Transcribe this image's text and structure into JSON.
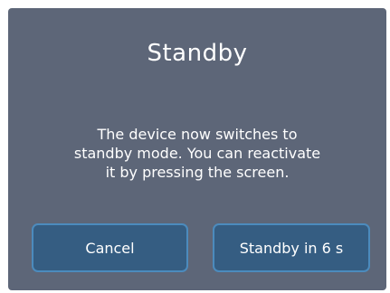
{
  "dialog": {
    "title": "Standby",
    "message_lines": [
      "The device now switches to",
      "standby mode. You can reactivate",
      "it by pressing the screen."
    ],
    "buttons": {
      "cancel_label": "Cancel",
      "standby_label": "Standby in 6 s"
    }
  },
  "colors": {
    "dialog_background": "#5d6678",
    "button_background": "#355d82",
    "button_border": "#4c8bbd",
    "text": "#ffffff"
  }
}
